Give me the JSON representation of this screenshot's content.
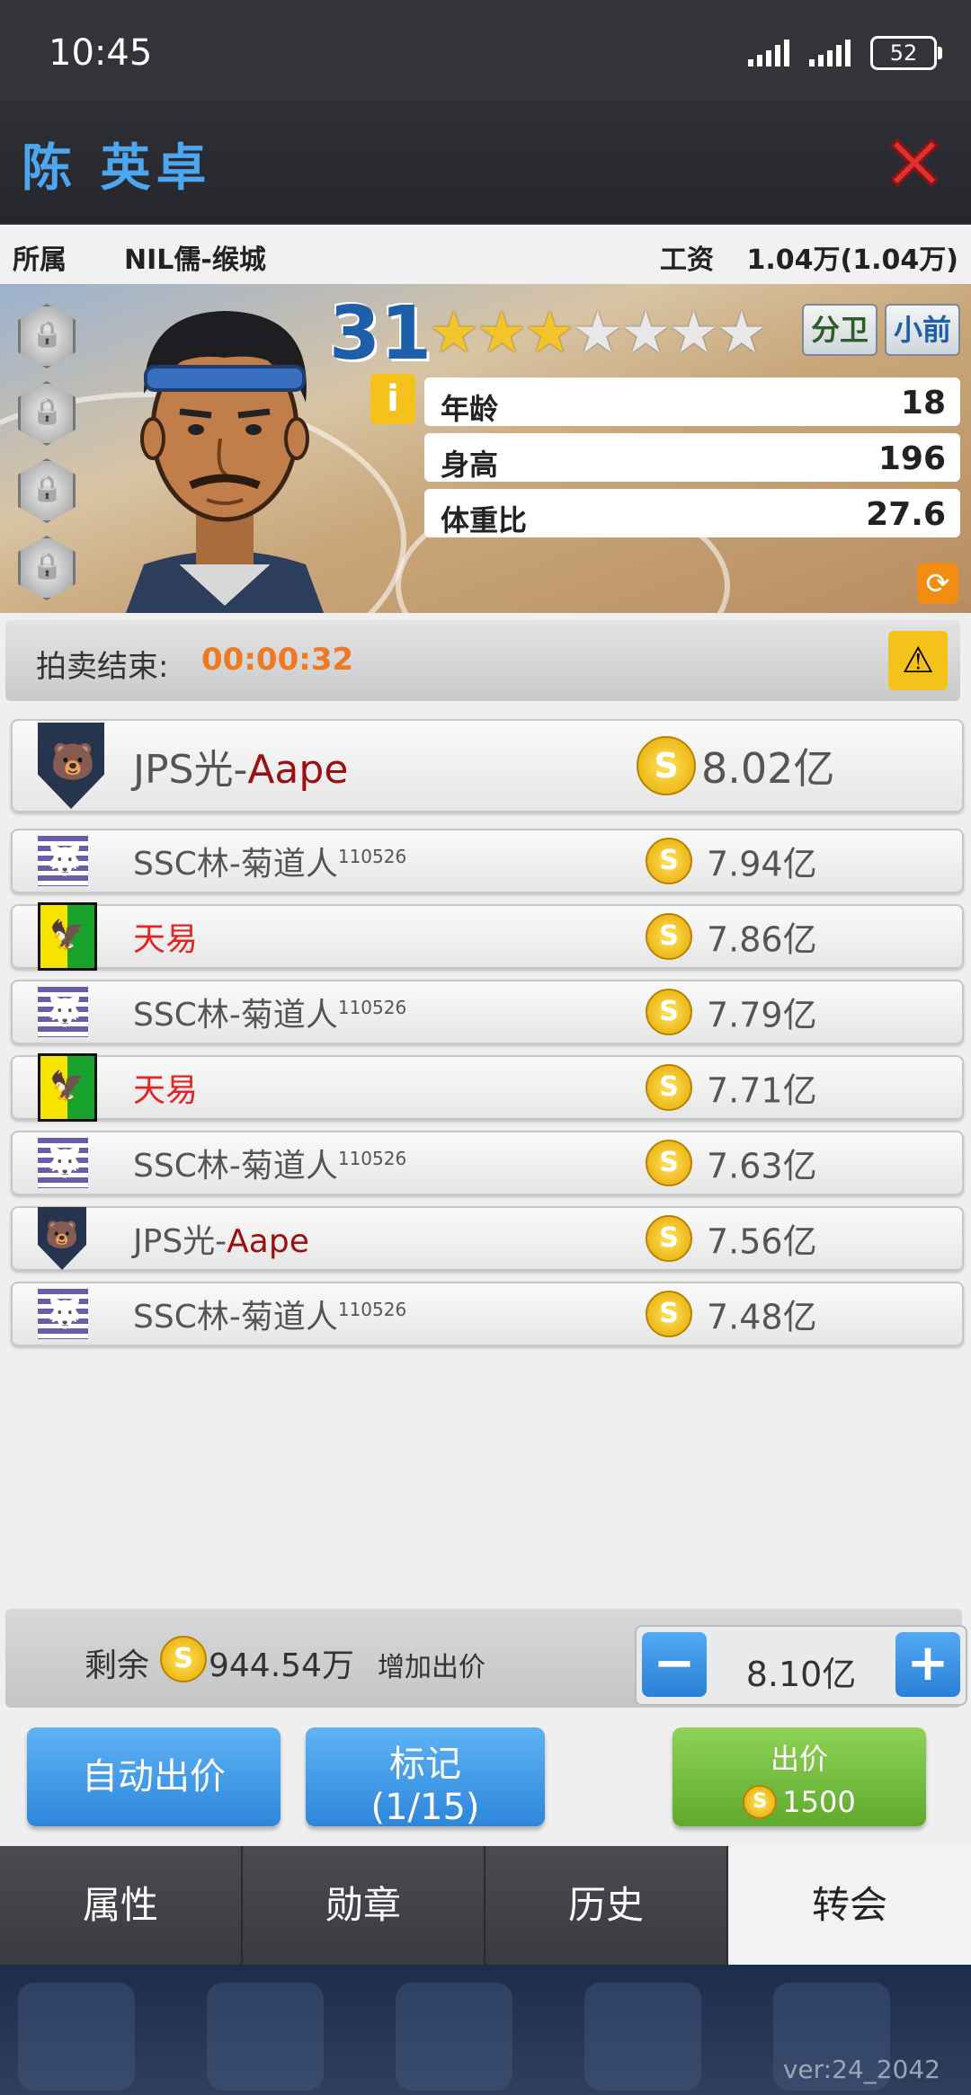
{
  "status_bar": {
    "time": "10:45",
    "battery": "52"
  },
  "header": {
    "player_name": "陈 英卓"
  },
  "affiliation": {
    "team_label": "所属",
    "team_value": "NIL儒-缑城",
    "salary_label": "工资",
    "salary_value": "1.04万(1.04万)"
  },
  "player": {
    "rating": "31",
    "stars_filled": 3,
    "stars_total": 7,
    "positions": [
      "分卫",
      "小前"
    ],
    "info_icon": "i",
    "stats": [
      {
        "label": "年龄",
        "value": "18"
      },
      {
        "label": "身高",
        "value": "196"
      },
      {
        "label": "体重比",
        "value": "27.6"
      }
    ]
  },
  "auction": {
    "label": "拍卖结束:",
    "time": "00:00:32"
  },
  "bids": [
    {
      "team_prefix": "JPS光-",
      "team_suffix": "Aape",
      "sup": "",
      "amount": "8.02亿",
      "logo": "jps-logo-icon"
    },
    {
      "team_prefix": "SSC林-菊道人",
      "team_suffix": "",
      "sup": "110526",
      "amount": "7.94亿",
      "logo": "ssc-logo-icon"
    },
    {
      "team_prefix": "",
      "team_suffix": "天易",
      "sup": "",
      "amount": "7.86亿",
      "logo": "tianyi-logo-icon"
    },
    {
      "team_prefix": "SSC林-菊道人",
      "team_suffix": "",
      "sup": "110526",
      "amount": "7.79亿",
      "logo": "ssc-logo-icon"
    },
    {
      "team_prefix": "",
      "team_suffix": "天易",
      "sup": "",
      "amount": "7.71亿",
      "logo": "tianyi-logo-icon"
    },
    {
      "team_prefix": "SSC林-菊道人",
      "team_suffix": "",
      "sup": "110526",
      "amount": "7.63亿",
      "logo": "ssc-logo-icon"
    },
    {
      "team_prefix": "JPS光-",
      "team_suffix": "Aape",
      "sup": "",
      "amount": "7.56亿",
      "logo": "jps-logo-icon"
    },
    {
      "team_prefix": "SSC林-菊道人",
      "team_suffix": "",
      "sup": "110526",
      "amount": "7.48亿",
      "logo": "ssc-logo-icon"
    }
  ],
  "coin_symbol": "S",
  "bottom": {
    "remain_label": "剩余",
    "remain_value": "944.54万",
    "raise_label": "增加出价",
    "bid_value": "8.10亿",
    "minus": "−",
    "plus": "+"
  },
  "actions": {
    "auto_bid": "自动出价",
    "mark_line1": "标记",
    "mark_line2": "(1/15)",
    "bid_label": "出价",
    "bid_cost": "1500"
  },
  "tabs": [
    {
      "label": "属性",
      "active": false
    },
    {
      "label": "勋章",
      "active": false
    },
    {
      "label": "历史",
      "active": false
    },
    {
      "label": "转会",
      "active": true
    }
  ],
  "footer": {
    "version": "ver:24_2042"
  },
  "colors": {
    "accent_blue": "#4da6f0",
    "timer_orange": "#f07820",
    "team_red": "#e32222",
    "bid_green": "#5eaa2c"
  }
}
